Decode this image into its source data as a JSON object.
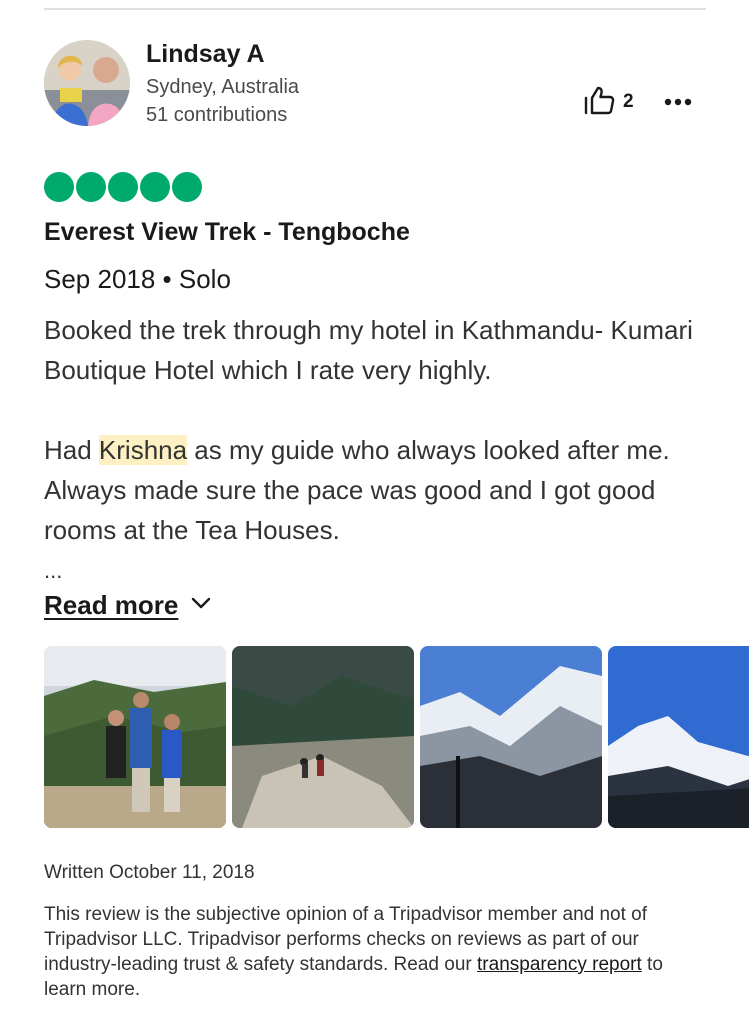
{
  "user": {
    "name": "Lindsay A",
    "location": "Sydney, Australia",
    "contributions": "51 contributions"
  },
  "helpful": {
    "count": "2",
    "icon": "thumbs-up-icon"
  },
  "more_icon": "more-options-icon",
  "rating": {
    "value": 5,
    "max": 5,
    "color": "#00aa6c"
  },
  "review": {
    "title": "Everest View Trek - Tengboche",
    "meta": "Sep 2018 • Solo",
    "para1": "Booked the trek through my hotel in Kathmandu- Kumari Boutique Hotel which I rate very highly.",
    "para2_before": "Had ",
    "para2_highlight": "Krishna",
    "para2_after": " as my guide who always looked after me. Always made sure the pace was good and I got good rooms at the Tea Houses.",
    "truncation": "...",
    "read_more": "Read more"
  },
  "photos": [
    {
      "label": "trekkers-group-photo"
    },
    {
      "label": "rocky-trail-photo"
    },
    {
      "label": "snowy-peaks-photo"
    },
    {
      "label": "everest-view-photo"
    }
  ],
  "written": "Written October 11, 2018",
  "disclaimer": {
    "text": "This review is the subjective opinion of a Tripadvisor member and not of Tripadvisor LLC. Tripadvisor performs checks on reviews as part of our industry-leading trust & safety standards. Read our ",
    "link": "transparency report",
    "suffix": " to learn more."
  }
}
